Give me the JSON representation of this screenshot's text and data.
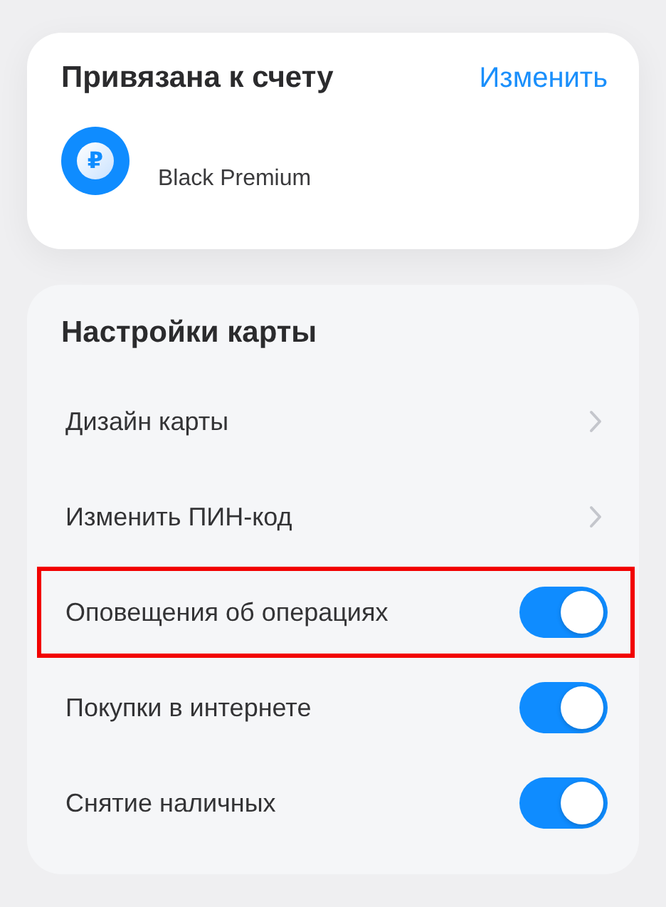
{
  "account_card": {
    "title": "Привязана к счету",
    "action": "Изменить",
    "account": {
      "symbol": "₽",
      "name": "Black Premium"
    }
  },
  "settings": {
    "title": "Настройки карты",
    "rows": [
      {
        "kind": "link",
        "label": "Дизайн карты",
        "highlighted": false
      },
      {
        "kind": "link",
        "label": "Изменить ПИН-код",
        "highlighted": false
      },
      {
        "kind": "toggle",
        "label": "Оповещения об операциях",
        "on": true,
        "highlighted": true
      },
      {
        "kind": "toggle",
        "label": "Покупки в интернете",
        "on": true,
        "highlighted": false
      },
      {
        "kind": "toggle",
        "label": "Снятие наличных",
        "on": true,
        "highlighted": false
      }
    ]
  }
}
